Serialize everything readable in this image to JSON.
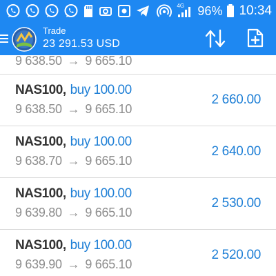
{
  "status_bar": {
    "network_type": "4G",
    "battery_percent": "96%",
    "time": "10:34",
    "icons": [
      "whatsapp-icon",
      "whatsapp-icon",
      "whatsapp-icon",
      "whatsapp-icon",
      "sd-card-icon",
      "camera-icon",
      "screenshot-icon",
      "telegram-icon",
      "hotspot-icon",
      "signal-icon",
      "battery-icon"
    ]
  },
  "header": {
    "title": "Trade",
    "balance": "23 291.53 USD",
    "accent_color": "#1e88f2",
    "icons": [
      "menu-icon",
      "metatrader-logo",
      "sort-icon",
      "new-order-icon"
    ]
  },
  "positions": [
    {
      "symbol": "",
      "side": "",
      "open_price": "9 638.50",
      "current_price": "9 665.10",
      "profit": "",
      "partial": true
    },
    {
      "symbol": "NAS100,",
      "side": "buy 100.00",
      "open_price": "9 638.50",
      "current_price": "9 665.10",
      "profit": "2 660.00"
    },
    {
      "symbol": "NAS100,",
      "side": "buy 100.00",
      "open_price": "9 638.70",
      "current_price": "9 665.10",
      "profit": "2 640.00"
    },
    {
      "symbol": "NAS100,",
      "side": "buy 100.00",
      "open_price": "9 639.80",
      "current_price": "9 665.10",
      "profit": "2 530.00"
    },
    {
      "symbol": "NAS100,",
      "side": "buy 100.00",
      "open_price": "9 639.90",
      "current_price": "9 665.10",
      "profit": "2 520.00"
    }
  ],
  "arrow": "→",
  "colors": {
    "profit": "#1e7fd6",
    "price": "#8d8d8d",
    "symbol": "#333333"
  }
}
